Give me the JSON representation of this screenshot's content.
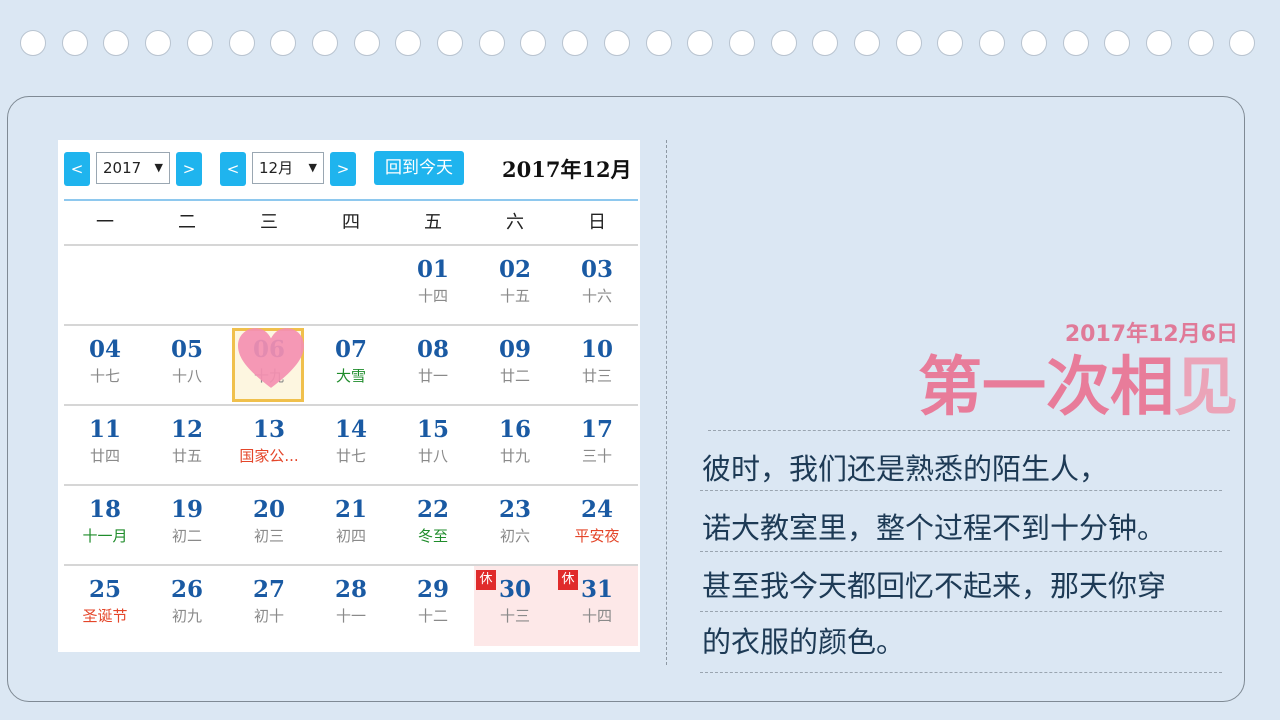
{
  "calendar": {
    "prev_label": "<",
    "next_label": ">",
    "year_value": "2017",
    "month_value": "12月",
    "today_button": "回到今天",
    "title": "2017年12月",
    "weekdays": [
      "一",
      "二",
      "三",
      "四",
      "五",
      "六",
      "日"
    ],
    "rest_badge": "休",
    "weeks": [
      [
        {
          "day": "",
          "sub": ""
        },
        {
          "day": "",
          "sub": ""
        },
        {
          "day": "",
          "sub": ""
        },
        {
          "day": "",
          "sub": ""
        },
        {
          "day": "01",
          "sub": "十四"
        },
        {
          "day": "02",
          "sub": "十五"
        },
        {
          "day": "03",
          "sub": "十六"
        }
      ],
      [
        {
          "day": "04",
          "sub": "十七"
        },
        {
          "day": "05",
          "sub": "十八"
        },
        {
          "day": "06",
          "sub": "十九",
          "selected": true
        },
        {
          "day": "07",
          "sub": "大雪",
          "tone": "green"
        },
        {
          "day": "08",
          "sub": "廿一"
        },
        {
          "day": "09",
          "sub": "廿二"
        },
        {
          "day": "10",
          "sub": "廿三"
        }
      ],
      [
        {
          "day": "11",
          "sub": "廿四"
        },
        {
          "day": "12",
          "sub": "廿五"
        },
        {
          "day": "13",
          "sub": "国家公...",
          "tone": "red"
        },
        {
          "day": "14",
          "sub": "廿七"
        },
        {
          "day": "15",
          "sub": "廿八"
        },
        {
          "day": "16",
          "sub": "廿九"
        },
        {
          "day": "17",
          "sub": "三十"
        }
      ],
      [
        {
          "day": "18",
          "sub": "十一月",
          "tone": "green"
        },
        {
          "day": "19",
          "sub": "初二"
        },
        {
          "day": "20",
          "sub": "初三"
        },
        {
          "day": "21",
          "sub": "初四"
        },
        {
          "day": "22",
          "sub": "冬至",
          "tone": "green"
        },
        {
          "day": "23",
          "sub": "初六"
        },
        {
          "day": "24",
          "sub": "平安夜",
          "tone": "red"
        }
      ],
      [
        {
          "day": "25",
          "sub": "圣诞节",
          "tone": "red"
        },
        {
          "day": "26",
          "sub": "初九"
        },
        {
          "day": "27",
          "sub": "初十"
        },
        {
          "day": "28",
          "sub": "十一"
        },
        {
          "day": "29",
          "sub": "十二"
        },
        {
          "day": "30",
          "sub": "十三",
          "rest": true
        },
        {
          "day": "31",
          "sub": "十四",
          "rest": true
        }
      ]
    ]
  },
  "story": {
    "date": "2017年12月6日",
    "headline_main": "第一次相",
    "headline_last": "见",
    "lines": [
      "彼时，我们还是熟悉的陌生人，",
      "诺大教室里，整个过程不到十分钟。",
      "甚至我今天都回忆不起来，那天你穿",
      "的衣服的颜色。"
    ]
  },
  "colors": {
    "background": "#dbe7f3",
    "button": "#1fb4ee",
    "day_number": "#1a5aa3",
    "headline": "#e87c9a",
    "heart": "#f48fb1"
  },
  "icons": {
    "heart": "heart-icon",
    "hole": "binder-hole"
  }
}
